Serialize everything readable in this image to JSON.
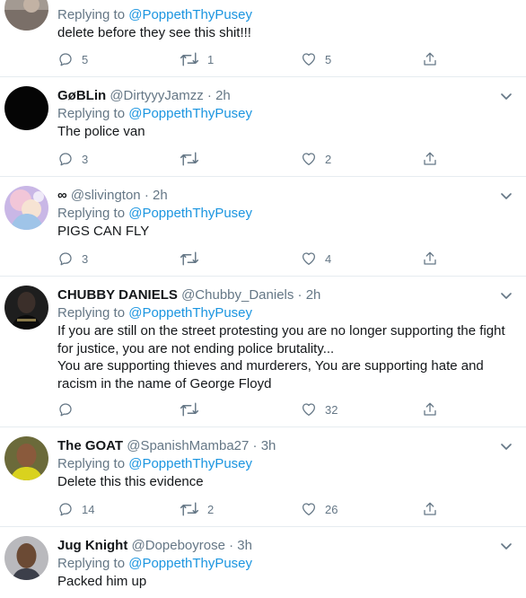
{
  "tweets": [
    {
      "name": "",
      "handle": "",
      "time": "",
      "replying_prefix": "Replying to",
      "replying_to": "@PoppethThyPusey",
      "text": [
        "delete before they see this shit!!!"
      ],
      "replies": "5",
      "retweets": "1",
      "likes": "5",
      "avatar": "partial-photo"
    },
    {
      "name": "GøBLin",
      "handle": "@DirtyyyJamzz",
      "time": "2h",
      "replying_prefix": "Replying to",
      "replying_to": "@PoppethThyPusey",
      "text": [
        "The police van"
      ],
      "replies": "3",
      "retweets": "",
      "likes": "2",
      "avatar": "black-circle"
    },
    {
      "name": "∞",
      "handle": "@slivington",
      "time": "2h",
      "replying_prefix": "Replying to",
      "replying_to": "@PoppethThyPusey",
      "text": [
        "PIGS CAN FLY"
      ],
      "replies": "3",
      "retweets": "",
      "likes": "4",
      "avatar": "pastel-anime"
    },
    {
      "name": "CHUBBY DANIELS",
      "handle": "@Chubby_Daniels",
      "time": "2h",
      "replying_prefix": "Replying to",
      "replying_to": "@PoppethThyPusey",
      "text": [
        "If you are still on the street protesting you are no longer supporting the fight",
        "for justice, you are not ending police brutality...",
        "You are supporting thieves and murderers, You are supporting hate and",
        "racism in the name of George Floyd"
      ],
      "replies": "",
      "retweets": "",
      "likes": "32",
      "avatar": "dark-portrait"
    },
    {
      "name": "The GOAT",
      "handle": "@SpanishMamba27",
      "time": "3h",
      "replying_prefix": "Replying to",
      "replying_to": "@PoppethThyPusey",
      "text": [
        "Delete this this evidence"
      ],
      "replies": "14",
      "retweets": "2",
      "likes": "26",
      "avatar": "yellow-portrait"
    },
    {
      "name": "Jug Knight",
      "handle": "@Dopeboyrose",
      "time": "3h",
      "replying_prefix": "Replying to",
      "replying_to": "@PoppethThyPusey",
      "text": [
        "Packed him up"
      ],
      "replies": "",
      "retweets": "",
      "likes": "",
      "avatar": "mugshot"
    }
  ],
  "colors": {
    "link": "#1b95e0",
    "muted": "#657786",
    "text": "#14171a",
    "divider": "#e6ecf0"
  },
  "icons": [
    "reply-icon",
    "retweet-icon",
    "like-icon",
    "share-icon",
    "chevron-down-icon"
  ]
}
